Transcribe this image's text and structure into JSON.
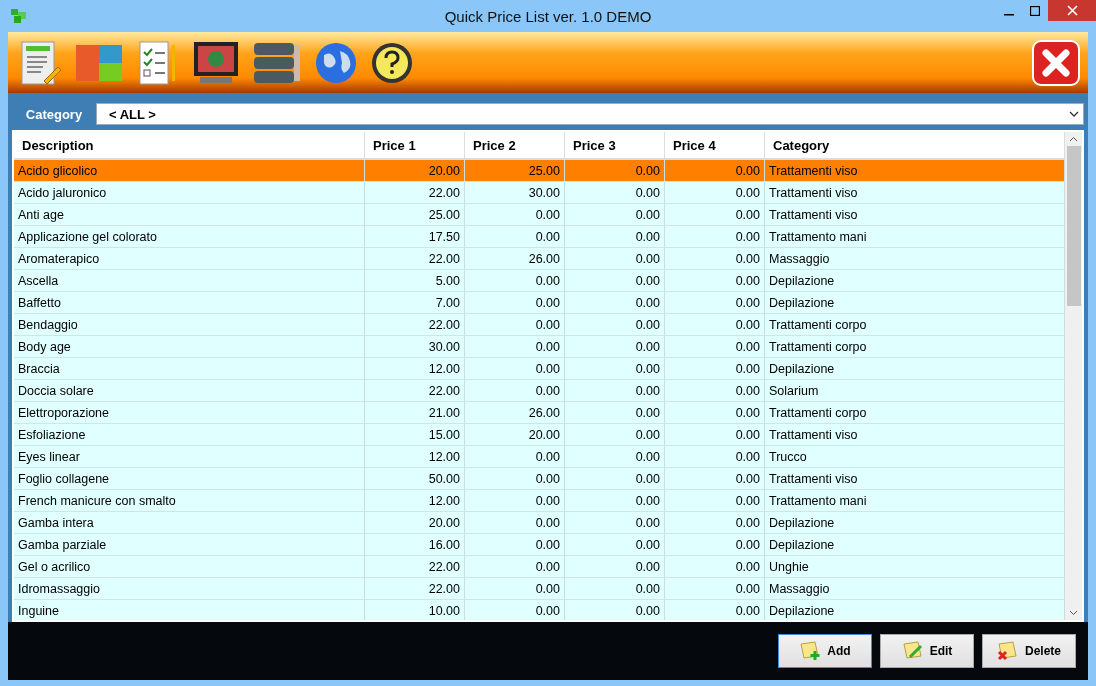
{
  "window": {
    "title": "Quick Price List ver. 1.0 DEMO"
  },
  "toolbar": {
    "tools": [
      {
        "kind": "document"
      },
      {
        "kind": "tiles"
      },
      {
        "kind": "checklist"
      },
      {
        "kind": "monitor"
      },
      {
        "kind": "server"
      },
      {
        "kind": "globe"
      },
      {
        "kind": "help"
      }
    ]
  },
  "filter": {
    "label": "Category",
    "value": "< ALL >"
  },
  "table": {
    "columns": [
      "Description",
      "Price 1",
      "Price 2",
      "Price 3",
      "Price 4",
      "Category"
    ],
    "rows": [
      {
        "cells": [
          "Acido glicolico",
          "20.00",
          "25.00",
          "0.00",
          "0.00",
          "Trattamenti viso"
        ],
        "selected": true
      },
      {
        "cells": [
          "Acido jaluronico",
          "22.00",
          "30.00",
          "0.00",
          "0.00",
          "Trattamenti viso"
        ],
        "selected": false
      },
      {
        "cells": [
          "Anti age",
          "25.00",
          "0.00",
          "0.00",
          "0.00",
          "Trattamenti viso"
        ],
        "selected": false
      },
      {
        "cells": [
          "Applicazione gel colorato",
          "17.50",
          "0.00",
          "0.00",
          "0.00",
          "Trattamento mani"
        ],
        "selected": false
      },
      {
        "cells": [
          "Aromaterapico",
          "22.00",
          "26.00",
          "0.00",
          "0.00",
          "Massaggio"
        ],
        "selected": false
      },
      {
        "cells": [
          "Ascella",
          "5.00",
          "0.00",
          "0.00",
          "0.00",
          "Depilazione"
        ],
        "selected": false
      },
      {
        "cells": [
          "Baffetto",
          "7.00",
          "0.00",
          "0.00",
          "0.00",
          "Depilazione"
        ],
        "selected": false
      },
      {
        "cells": [
          "Bendaggio",
          "22.00",
          "0.00",
          "0.00",
          "0.00",
          "Trattamenti corpo"
        ],
        "selected": false
      },
      {
        "cells": [
          "Body age",
          "30.00",
          "0.00",
          "0.00",
          "0.00",
          "Trattamenti corpo"
        ],
        "selected": false
      },
      {
        "cells": [
          "Braccia",
          "12.00",
          "0.00",
          "0.00",
          "0.00",
          "Depilazione"
        ],
        "selected": false
      },
      {
        "cells": [
          "Doccia solare",
          "22.00",
          "0.00",
          "0.00",
          "0.00",
          "Solarium"
        ],
        "selected": false
      },
      {
        "cells": [
          "Elettroporazione",
          "21.00",
          "26.00",
          "0.00",
          "0.00",
          "Trattamenti corpo"
        ],
        "selected": false
      },
      {
        "cells": [
          "Esfoliazione",
          "15.00",
          "20.00",
          "0.00",
          "0.00",
          "Trattamenti viso"
        ],
        "selected": false
      },
      {
        "cells": [
          "Eyes linear",
          "12.00",
          "0.00",
          "0.00",
          "0.00",
          "Trucco"
        ],
        "selected": false
      },
      {
        "cells": [
          "Foglio collagene",
          "50.00",
          "0.00",
          "0.00",
          "0.00",
          "Trattamenti viso"
        ],
        "selected": false
      },
      {
        "cells": [
          "French manicure con smalto",
          "12.00",
          "0.00",
          "0.00",
          "0.00",
          "Trattamento mani"
        ],
        "selected": false
      },
      {
        "cells": [
          "Gamba intera",
          "20.00",
          "0.00",
          "0.00",
          "0.00",
          "Depilazione"
        ],
        "selected": false
      },
      {
        "cells": [
          "Gamba parziale",
          "16.00",
          "0.00",
          "0.00",
          "0.00",
          "Depilazione"
        ],
        "selected": false
      },
      {
        "cells": [
          "Gel o acrilico",
          "22.00",
          "0.00",
          "0.00",
          "0.00",
          "Unghie"
        ],
        "selected": false
      },
      {
        "cells": [
          "Idromassaggio",
          "22.00",
          "0.00",
          "0.00",
          "0.00",
          "Massaggio"
        ],
        "selected": false
      },
      {
        "cells": [
          "Inguine",
          "10.00",
          "0.00",
          "0.00",
          "0.00",
          "Depilazione"
        ],
        "selected": false
      }
    ]
  },
  "buttons": [
    {
      "label": "Add",
      "kind": "add"
    },
    {
      "label": "Edit",
      "kind": "edit"
    },
    {
      "label": "Delete",
      "kind": "delete"
    }
  ]
}
